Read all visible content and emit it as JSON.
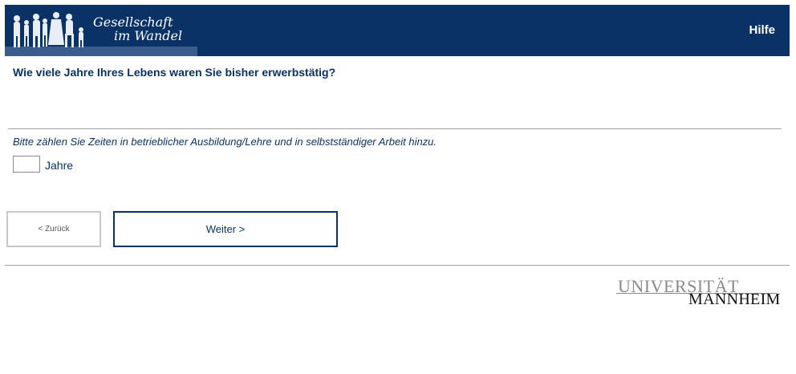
{
  "header": {
    "logo_line1": "Gesellschaft",
    "logo_line2": "im Wandel",
    "help_label": "Hilfe",
    "background_color": "#0b3266"
  },
  "survey": {
    "question": "Wie viele Jahre Ihres Lebens waren Sie bisher erwerbstätig?",
    "hint": "Bitte zählen Sie Zeiten in betrieblicher Ausbildung/Lehre und in selbstständiger Arbeit hinzu.",
    "years_value": "",
    "unit_label": "Jahre"
  },
  "navigation": {
    "back_label": "< Zurück",
    "next_label": "Weiter >"
  },
  "footer": {
    "university_line1": "UNIVERSITÄT",
    "university_line2": "MANNHEIM"
  },
  "icons": [
    "silhouettes-logo-icon"
  ]
}
